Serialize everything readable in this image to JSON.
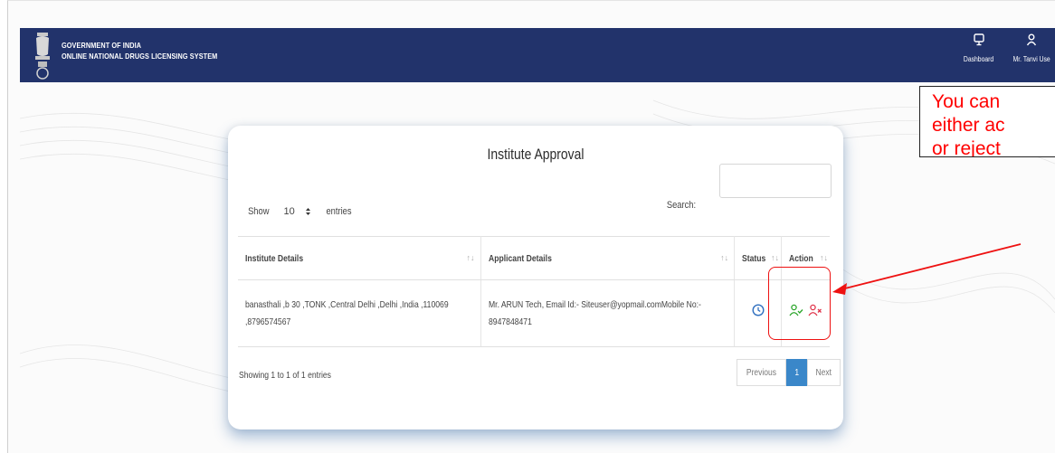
{
  "header": {
    "line1": "GOVERNMENT OF INDIA",
    "line2": "ONLINE NATIONAL DRUGS LICENSING SYSTEM",
    "nav": [
      {
        "label": "Dashboard",
        "icon": "monitor-icon"
      },
      {
        "label": "Mr. Tanvi Use",
        "icon": "user-icon"
      }
    ]
  },
  "card": {
    "title": "Institute Approval",
    "length": {
      "show": "Show",
      "value": "10",
      "entries": "entries"
    },
    "search": {
      "label": "Search:",
      "value": ""
    },
    "table": {
      "columns": [
        "Institute Details",
        "Applicant Details",
        "Status",
        "Action"
      ],
      "rows": [
        {
          "institute": "banasthali ,b 30 ,TONK ,Central Delhi ,Delhi ,India ,110069 ,8796574567",
          "applicant": "Mr. ARUN Tech, Email Id:- Siteuser@yopmail.comMobile No:- 8947848471",
          "status_icon": "clock-icon",
          "actions": [
            "accept-user-icon",
            "reject-user-icon"
          ]
        }
      ]
    },
    "info": "Showing 1 to 1 of 1 entries",
    "pagination": {
      "previous": "Previous",
      "current": "1",
      "next": "Next"
    }
  },
  "annotation": {
    "text": "You can\neither ac\nor reject"
  },
  "colors": {
    "navbar": "#22336b",
    "accept": "#2aa52a",
    "reject": "#e0344a",
    "annotation": "#ff0000",
    "page_active": "#3a87c9"
  }
}
